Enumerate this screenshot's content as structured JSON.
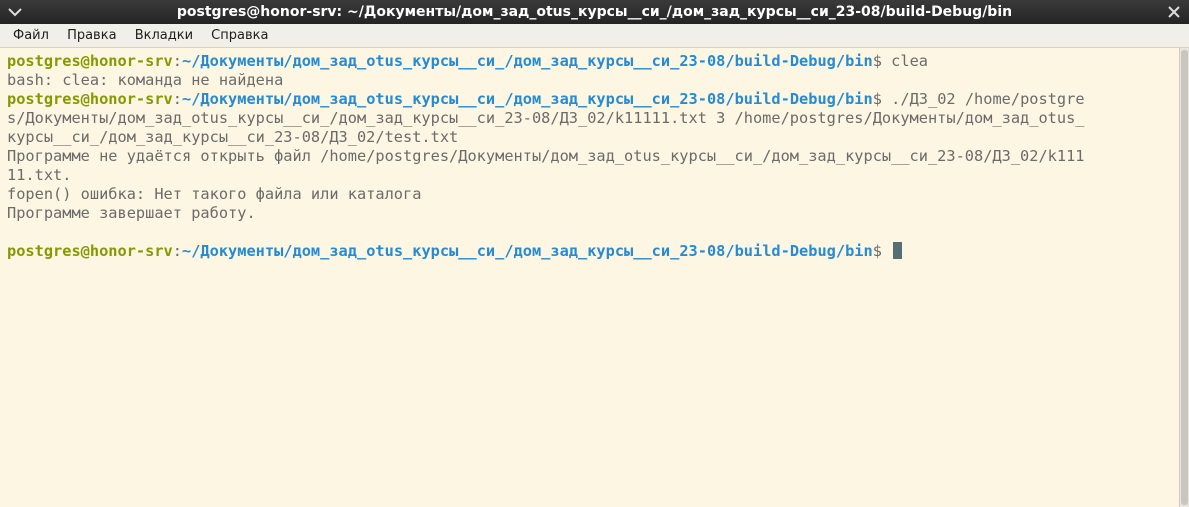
{
  "window": {
    "title": "postgres@honor-srv: ~/Документы/дом_зад_otus_курсы__си_/дом_зад_курсы__си_23-08/build-Debug/bin"
  },
  "menu": {
    "items": [
      "Файл",
      "Правка",
      "Вкладки",
      "Справка"
    ]
  },
  "terminal": {
    "prompt": {
      "user_host": "postgres@honor-srv",
      "separator": ":",
      "path": "~/Документы/дом_зад_otus_курсы__си_/дом_зад_курсы__си_23-08/build-Debug/bin",
      "symbol": "$"
    },
    "cmd1": " clea",
    "out1": "bash: clea: команда не найдена",
    "cmd2": " ./ДЗ_02 /home/postgre",
    "wrap2a": "s/Документы/дом_зад_otus_курсы__си_/дом_зад_курсы__си_23-08/ДЗ_02/k11111.txt 3 /home/postgres/Документы/дом_зад_otus_",
    "wrap2b": "курсы__си_/дом_зад_курсы__си_23-08/ДЗ_02/test.txt",
    "out2a": "Программе не удаётся открыть файл /home/postgres/Документы/дом_зад_otus_курсы__си_/дом_зад_курсы__си_23-08/ДЗ_02/k111",
    "out2b": "11.txt.",
    "out2c": "fopen() ошибка: Нет такого файла или каталога",
    "out2d": "Программе завершает работу.",
    "cmd3": " "
  },
  "colors": {
    "user": "#859900",
    "path": "#268bd2",
    "background": "#fdf6e3",
    "text": "#6b6b6b"
  }
}
